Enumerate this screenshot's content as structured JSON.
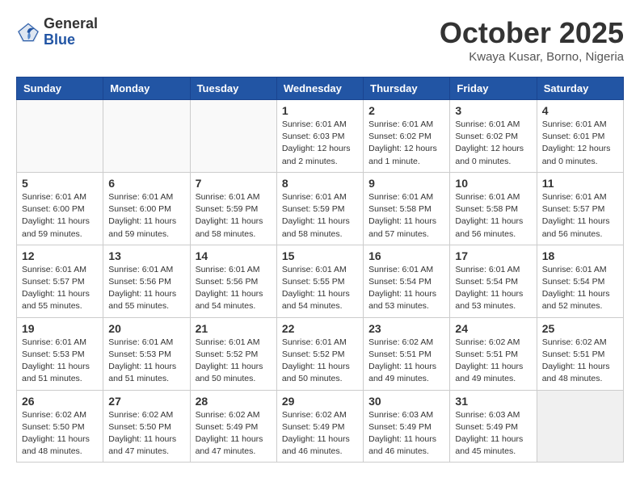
{
  "header": {
    "logo_general": "General",
    "logo_blue": "Blue",
    "month_title": "October 2025",
    "location": "Kwaya Kusar, Borno, Nigeria"
  },
  "weekdays": [
    "Sunday",
    "Monday",
    "Tuesday",
    "Wednesday",
    "Thursday",
    "Friday",
    "Saturday"
  ],
  "weeks": [
    [
      {
        "day": "",
        "info": ""
      },
      {
        "day": "",
        "info": ""
      },
      {
        "day": "",
        "info": ""
      },
      {
        "day": "1",
        "info": "Sunrise: 6:01 AM\nSunset: 6:03 PM\nDaylight: 12 hours\nand 2 minutes."
      },
      {
        "day": "2",
        "info": "Sunrise: 6:01 AM\nSunset: 6:02 PM\nDaylight: 12 hours\nand 1 minute."
      },
      {
        "day": "3",
        "info": "Sunrise: 6:01 AM\nSunset: 6:02 PM\nDaylight: 12 hours\nand 0 minutes."
      },
      {
        "day": "4",
        "info": "Sunrise: 6:01 AM\nSunset: 6:01 PM\nDaylight: 12 hours\nand 0 minutes."
      }
    ],
    [
      {
        "day": "5",
        "info": "Sunrise: 6:01 AM\nSunset: 6:00 PM\nDaylight: 11 hours\nand 59 minutes."
      },
      {
        "day": "6",
        "info": "Sunrise: 6:01 AM\nSunset: 6:00 PM\nDaylight: 11 hours\nand 59 minutes."
      },
      {
        "day": "7",
        "info": "Sunrise: 6:01 AM\nSunset: 5:59 PM\nDaylight: 11 hours\nand 58 minutes."
      },
      {
        "day": "8",
        "info": "Sunrise: 6:01 AM\nSunset: 5:59 PM\nDaylight: 11 hours\nand 58 minutes."
      },
      {
        "day": "9",
        "info": "Sunrise: 6:01 AM\nSunset: 5:58 PM\nDaylight: 11 hours\nand 57 minutes."
      },
      {
        "day": "10",
        "info": "Sunrise: 6:01 AM\nSunset: 5:58 PM\nDaylight: 11 hours\nand 56 minutes."
      },
      {
        "day": "11",
        "info": "Sunrise: 6:01 AM\nSunset: 5:57 PM\nDaylight: 11 hours\nand 56 minutes."
      }
    ],
    [
      {
        "day": "12",
        "info": "Sunrise: 6:01 AM\nSunset: 5:57 PM\nDaylight: 11 hours\nand 55 minutes."
      },
      {
        "day": "13",
        "info": "Sunrise: 6:01 AM\nSunset: 5:56 PM\nDaylight: 11 hours\nand 55 minutes."
      },
      {
        "day": "14",
        "info": "Sunrise: 6:01 AM\nSunset: 5:56 PM\nDaylight: 11 hours\nand 54 minutes."
      },
      {
        "day": "15",
        "info": "Sunrise: 6:01 AM\nSunset: 5:55 PM\nDaylight: 11 hours\nand 54 minutes."
      },
      {
        "day": "16",
        "info": "Sunrise: 6:01 AM\nSunset: 5:54 PM\nDaylight: 11 hours\nand 53 minutes."
      },
      {
        "day": "17",
        "info": "Sunrise: 6:01 AM\nSunset: 5:54 PM\nDaylight: 11 hours\nand 53 minutes."
      },
      {
        "day": "18",
        "info": "Sunrise: 6:01 AM\nSunset: 5:54 PM\nDaylight: 11 hours\nand 52 minutes."
      }
    ],
    [
      {
        "day": "19",
        "info": "Sunrise: 6:01 AM\nSunset: 5:53 PM\nDaylight: 11 hours\nand 51 minutes."
      },
      {
        "day": "20",
        "info": "Sunrise: 6:01 AM\nSunset: 5:53 PM\nDaylight: 11 hours\nand 51 minutes."
      },
      {
        "day": "21",
        "info": "Sunrise: 6:01 AM\nSunset: 5:52 PM\nDaylight: 11 hours\nand 50 minutes."
      },
      {
        "day": "22",
        "info": "Sunrise: 6:01 AM\nSunset: 5:52 PM\nDaylight: 11 hours\nand 50 minutes."
      },
      {
        "day": "23",
        "info": "Sunrise: 6:02 AM\nSunset: 5:51 PM\nDaylight: 11 hours\nand 49 minutes."
      },
      {
        "day": "24",
        "info": "Sunrise: 6:02 AM\nSunset: 5:51 PM\nDaylight: 11 hours\nand 49 minutes."
      },
      {
        "day": "25",
        "info": "Sunrise: 6:02 AM\nSunset: 5:51 PM\nDaylight: 11 hours\nand 48 minutes."
      }
    ],
    [
      {
        "day": "26",
        "info": "Sunrise: 6:02 AM\nSunset: 5:50 PM\nDaylight: 11 hours\nand 48 minutes."
      },
      {
        "day": "27",
        "info": "Sunrise: 6:02 AM\nSunset: 5:50 PM\nDaylight: 11 hours\nand 47 minutes."
      },
      {
        "day": "28",
        "info": "Sunrise: 6:02 AM\nSunset: 5:49 PM\nDaylight: 11 hours\nand 47 minutes."
      },
      {
        "day": "29",
        "info": "Sunrise: 6:02 AM\nSunset: 5:49 PM\nDaylight: 11 hours\nand 46 minutes."
      },
      {
        "day": "30",
        "info": "Sunrise: 6:03 AM\nSunset: 5:49 PM\nDaylight: 11 hours\nand 46 minutes."
      },
      {
        "day": "31",
        "info": "Sunrise: 6:03 AM\nSunset: 5:49 PM\nDaylight: 11 hours\nand 45 minutes."
      },
      {
        "day": "",
        "info": ""
      }
    ]
  ]
}
